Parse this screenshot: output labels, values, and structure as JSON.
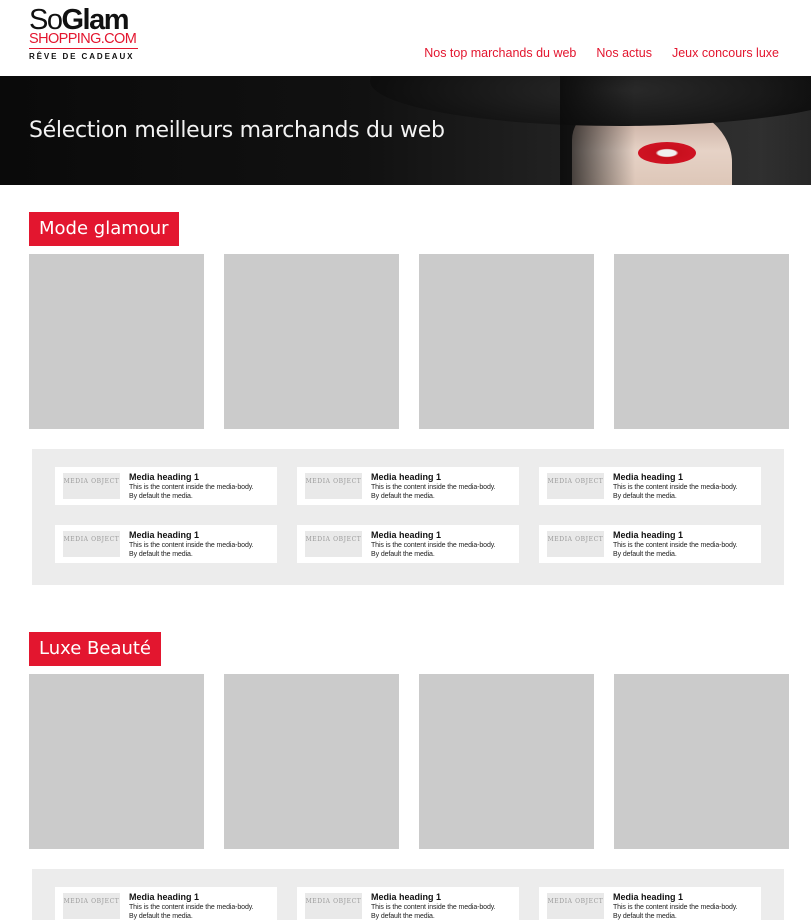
{
  "logo": {
    "so": "So",
    "glam": "Glam",
    "shop": "SHOPPING.COM",
    "tagline": "RÊVE DE CADEAUX"
  },
  "nav": {
    "items": [
      {
        "label": "Nos top marchands du web"
      },
      {
        "label": "Nos actus"
      },
      {
        "label": "Jeux concours luxe"
      }
    ]
  },
  "banner": {
    "title": "Sélection meilleurs marchands du web"
  },
  "sections": [
    {
      "title": "Mode glamour",
      "media": [
        {
          "thumb": "MEDIA OBJECT",
          "heading": "Media heading 1",
          "line1": "This is the content inside the media-body.",
          "line2": "By default the media."
        },
        {
          "thumb": "MEDIA OBJECT",
          "heading": "Media heading 1",
          "line1": "This is the content inside the media-body.",
          "line2": "By default the media."
        },
        {
          "thumb": "MEDIA OBJECT",
          "heading": "Media heading 1",
          "line1": "This is the content inside the media-body.",
          "line2": "By default the media."
        },
        {
          "thumb": "MEDIA OBJECT",
          "heading": "Media heading 1",
          "line1": "This is the content inside the media-body.",
          "line2": "By default the media."
        },
        {
          "thumb": "MEDIA OBJECT",
          "heading": "Media heading 1",
          "line1": "This is the content inside the media-body.",
          "line2": "By default the media."
        },
        {
          "thumb": "MEDIA OBJECT",
          "heading": "Media heading 1",
          "line1": "This is the content inside the media-body.",
          "line2": "By default the media."
        }
      ]
    },
    {
      "title": "Luxe Beauté",
      "media": [
        {
          "thumb": "MEDIA OBJECT",
          "heading": "Media heading 1",
          "line1": "This is the content inside the media-body.",
          "line2": "By default the media."
        },
        {
          "thumb": "MEDIA OBJECT",
          "heading": "Media heading 1",
          "line1": "This is the content inside the media-body.",
          "line2": "By default the media."
        },
        {
          "thumb": "MEDIA OBJECT",
          "heading": "Media heading 1",
          "line1": "This is the content inside the media-body.",
          "line2": "By default the media."
        }
      ]
    }
  ],
  "colors": {
    "accent": "#e3162f",
    "tile": "#cbcbcb",
    "panel": "#ececec"
  }
}
